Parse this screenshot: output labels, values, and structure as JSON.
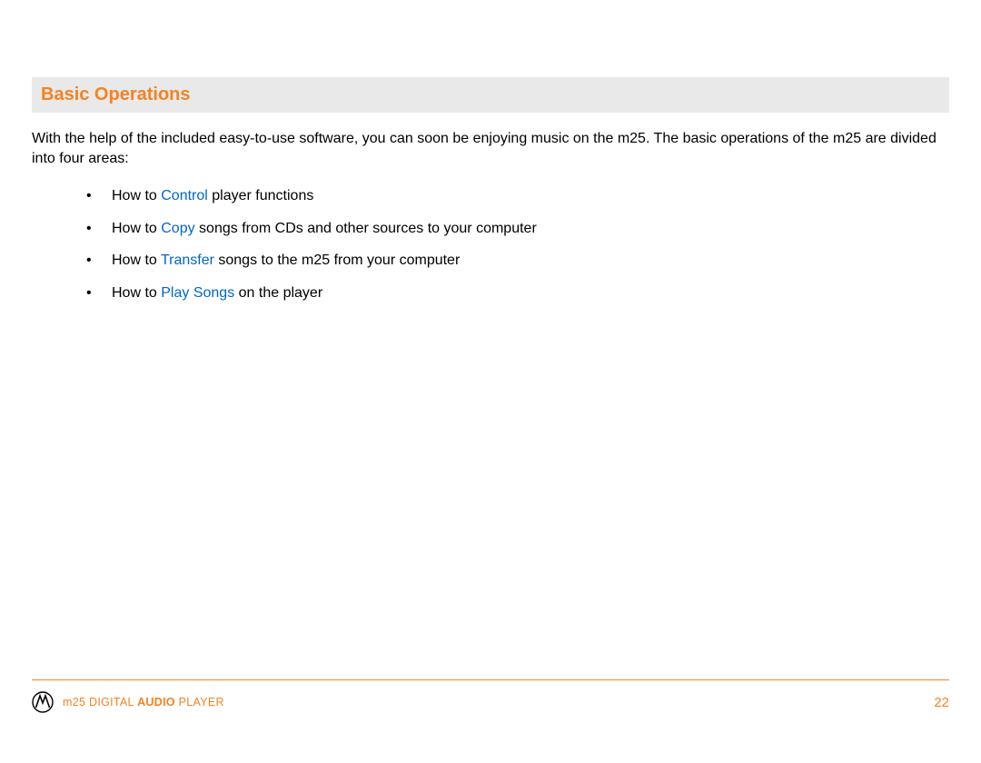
{
  "section": {
    "title": "Basic Operations",
    "intro": "With the help of the included easy-to-use software, you can soon be enjoying music on the m25. The basic operations of the m25 are divided into four areas:"
  },
  "list": [
    {
      "pre": "How to ",
      "link": "Control",
      "post": " player functions"
    },
    {
      "pre": "How to ",
      "link": "Copy",
      "post": " songs from CDs and other sources to your computer"
    },
    {
      "pre": "How to ",
      "link": "Transfer",
      "post": " songs to the m25 from your computer"
    },
    {
      "pre": "How to ",
      "link": "Play Songs",
      "post": " on the player"
    }
  ],
  "footer": {
    "text_pre": "m25 DIGITAL ",
    "text_bold": "AUDIO",
    "text_post": " PLAYER",
    "page_number": "22"
  },
  "colors": {
    "accent": "#f58220",
    "link": "#0066cc",
    "title_bg": "#e9e9e9"
  }
}
